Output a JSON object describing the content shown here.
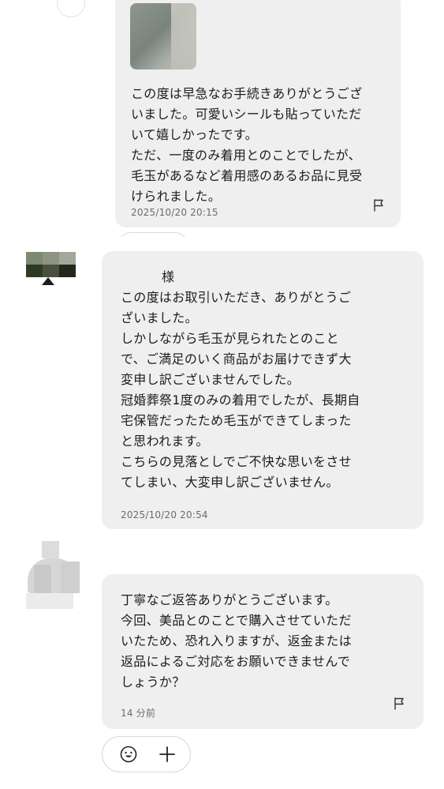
{
  "messages": [
    {
      "text": "この度は早急なお手続きありがとうござ\nいました。可愛いシールも貼っていただ\nいて嬉しかったです。\nただ、一度のみ着用とのことでしたが、\n毛玉があるなど着用感のあるお品に見受\nけられました。",
      "timestamp": "2025/10/20 20:15"
    },
    {
      "recipient_suffix": "様",
      "text": "この度はお取引いただき、ありがとうご\nざいました。\nしかしながら毛玉が見られたとのこと\nで、ご満足のいく商品がお届けできず大\n変申し訳ございませんでした。\n冠婚葬祭1度のみの着用でしたが、長期自\n宅保管だったため毛玉ができてしまった\nと思われます。\nこちらの見落としでご不快な思いをさせ\nてしまい、大変申し訳ございません。",
      "timestamp": "2025/10/20 20:54"
    },
    {
      "text": "丁寧なご返答ありがとうございます。\n今回、美品とのことで購入させていただ\nいたため、恐れ入りますが、返金または\n返品によるご対応をお願いできませんで\nしょうか？",
      "timestamp": "14 分前"
    }
  ],
  "icons": {
    "flag": "flag-icon",
    "smile": "smile-icon",
    "add": "plus-icon"
  },
  "colors": {
    "bubble_bg": "#efefef",
    "text": "#1c1c1c",
    "timestamp": "#6c6c6c"
  }
}
